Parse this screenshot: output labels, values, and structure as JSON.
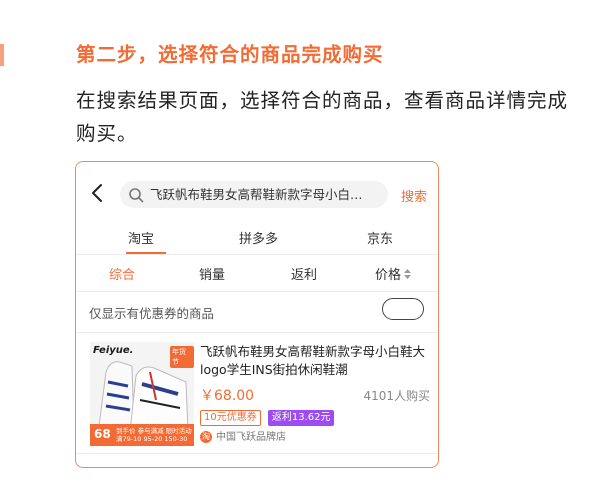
{
  "header": {
    "step_title": "第二步，选择符合的商品完成购买",
    "description": "在搜索结果页面，选择符合的商品，查看商品详情完成购买。"
  },
  "app": {
    "search": {
      "query": "飞跃帆布鞋男女高帮鞋新款字母小白…",
      "button_label": "搜索"
    },
    "platform_tabs": [
      {
        "label": "淘宝",
        "active": true
      },
      {
        "label": "拼多多",
        "active": false
      },
      {
        "label": "京东",
        "active": false
      }
    ],
    "sort_options": [
      {
        "label": "综合",
        "active": true
      },
      {
        "label": "销量",
        "active": false
      },
      {
        "label": "返利",
        "active": false
      },
      {
        "label": "价格",
        "active": false
      }
    ],
    "filter": {
      "coupon_only_label": "仅显示有优惠券的商品",
      "coupon_only_enabled": false
    },
    "product": {
      "image_brand": "Feiyue.",
      "image_tag": "年货节",
      "image_price": "68",
      "image_promo_line1": "到手价 参与满减 限时活动",
      "image_promo_line2": "满79-10 95-20 150-30",
      "title": "飞跃帆布鞋男女高帮鞋新款字母小白鞋大logo学生INS街拍休闲鞋潮",
      "price": "￥68.00",
      "sales": "4101人购买",
      "coupon_badge": "10元优惠券",
      "rebate_badge": "返利13.62元",
      "shop_icon": "淘",
      "shop_name": "中国飞跃品牌店"
    },
    "colors": {
      "accent": "#f26b35",
      "rebate": "#9c4cf0"
    }
  }
}
